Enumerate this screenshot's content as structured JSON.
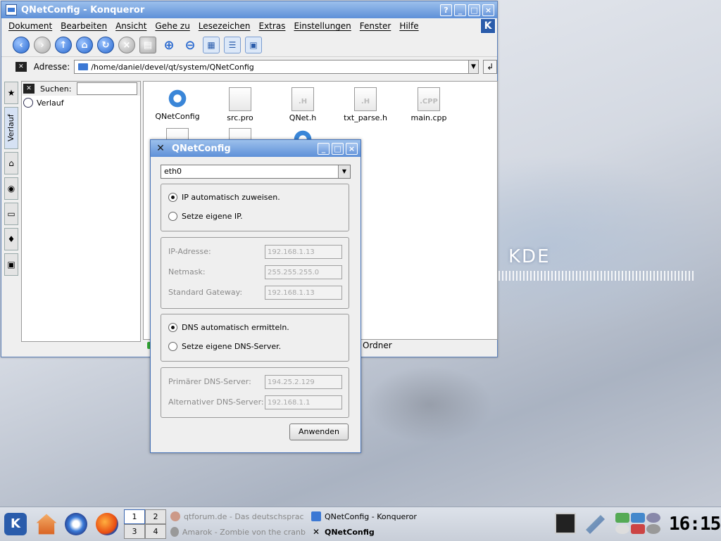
{
  "desktop": {
    "logo_text": "KDE"
  },
  "konqueror": {
    "title": "QNetConfig - Konqueror",
    "title_buttons": [
      "?",
      "_",
      "□",
      "×"
    ],
    "menu": [
      "Dokument",
      "Bearbeiten",
      "Ansicht",
      "Gehe zu",
      "Lesezeichen",
      "Extras",
      "Einstellungen",
      "Fenster",
      "Hilfe"
    ],
    "address_label": "Adresse:",
    "address_value": "/home/daniel/devel/qt/system/QNetConfig",
    "search_label": "Suchen:",
    "search_value": "",
    "sidebar_tab_label": "Verlauf",
    "tree_item": "Verlauf",
    "files": [
      {
        "name": "QNetConfig",
        "icon": "gear-icon"
      },
      {
        "name": "src.pro",
        "icon": "text-file-icon"
      },
      {
        "name": "QNet.h",
        "icon": "header-file-icon",
        "ext": ".H"
      },
      {
        "name": "txt_parse.h",
        "icon": "header-file-icon",
        "ext": ".H"
      },
      {
        "name": "main.cpp",
        "icon": "cpp-file-icon",
        "ext": ".CPP"
      }
    ],
    "status_text": "Ordner"
  },
  "dialog": {
    "title": "QNetConfig",
    "interface_selected": "eth0",
    "ip_auto_label": "IP automatisch zuweisen.",
    "ip_manual_label": "Setze eigene IP.",
    "ip_address_label": "IP-Adresse:",
    "ip_address_value": "192.168.1.13",
    "netmask_label": "Netmask:",
    "netmask_value": "255.255.255.0",
    "gateway_label": "Standard Gateway:",
    "gateway_value": "192.168.1.13",
    "dns_auto_label": "DNS automatisch ermitteln.",
    "dns_manual_label": "Setze eigene DNS-Server.",
    "dns_primary_label": "Primärer DNS-Server:",
    "dns_primary_value": "194.25.2.129",
    "dns_alt_label": "Alternativer DNS-Server:",
    "dns_alt_value": "192.168.1.1",
    "apply_label": "Anwenden"
  },
  "taskbar": {
    "pager": [
      "1",
      "2",
      "3",
      "4"
    ],
    "tasks": [
      {
        "label": "qtforum.de - Das deutschsprac",
        "active": false
      },
      {
        "label": "QNetConfig - Konqueror",
        "active": false
      },
      {
        "label": "Amarok - Zombie von the cranb",
        "active": false
      },
      {
        "label": "QNetConfig",
        "active": true
      }
    ],
    "clock": "16:15"
  }
}
